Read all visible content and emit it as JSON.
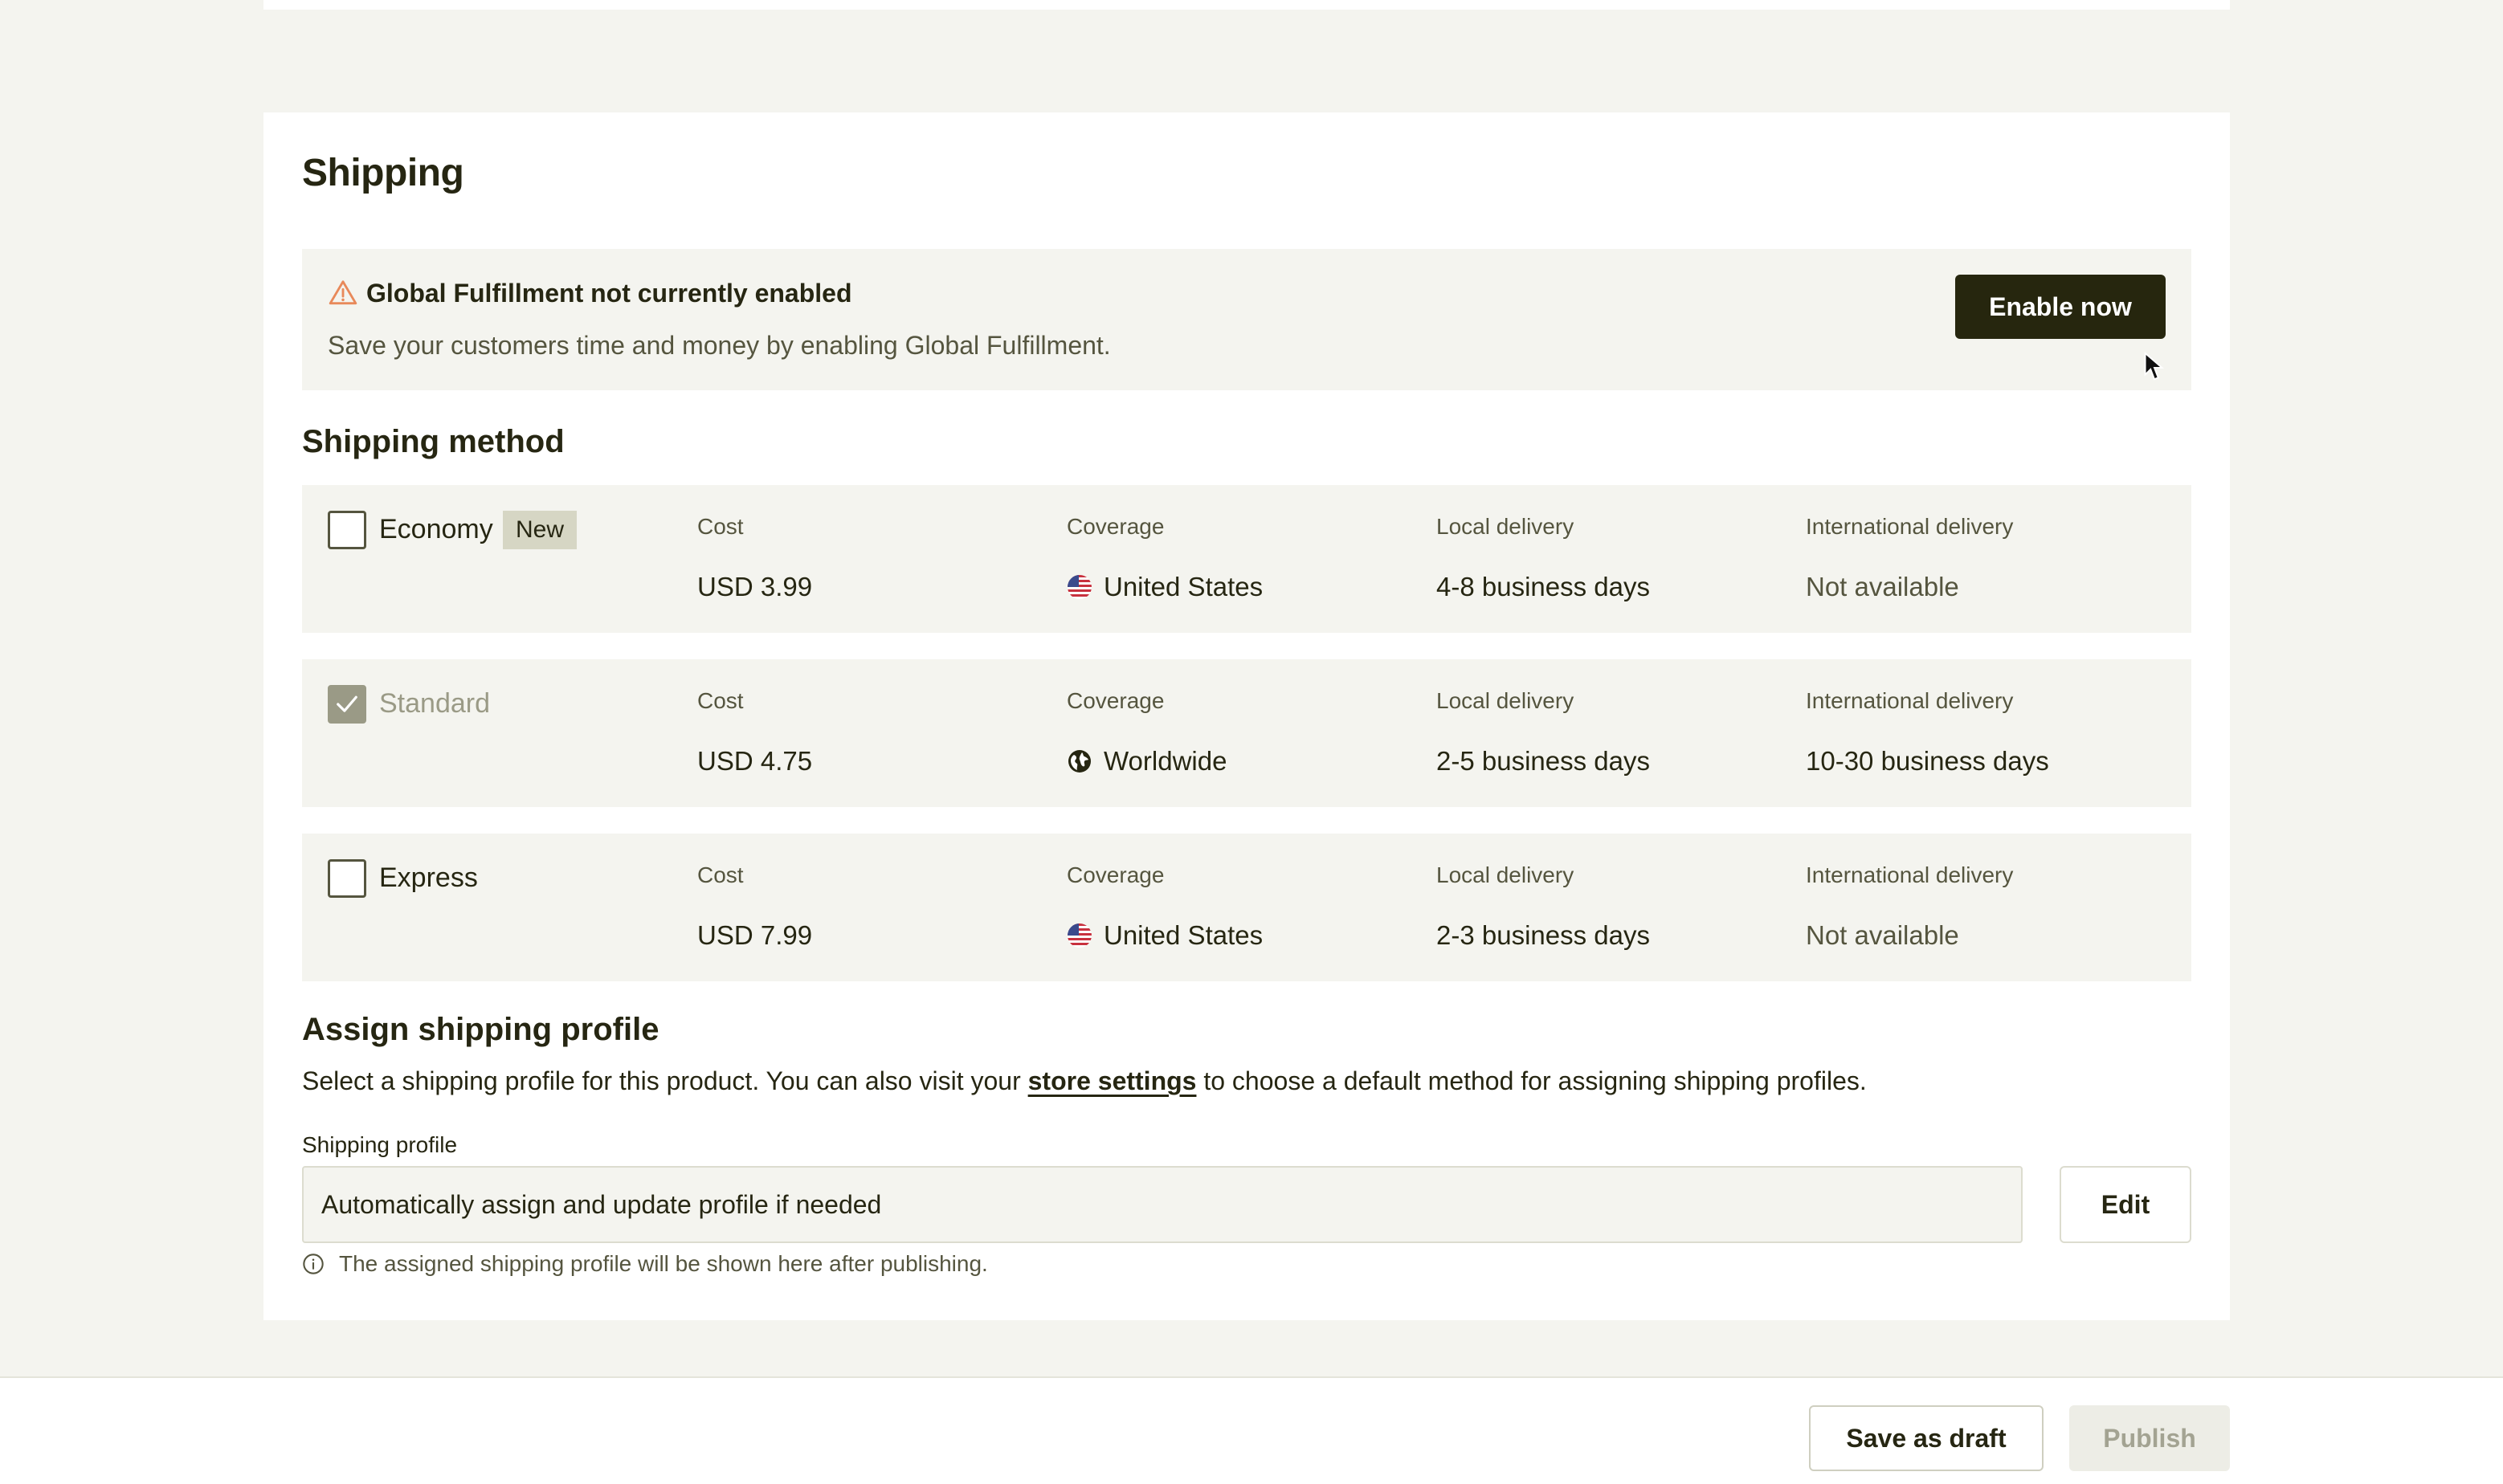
{
  "shipping": {
    "title": "Shipping",
    "banner": {
      "title": "Global Fulfillment not currently enabled",
      "description": "Save your customers time and money by enabling Global Fulfillment.",
      "button_label": "Enable now",
      "icon": "warning-triangle-icon",
      "icon_color": "#e8895a"
    },
    "method_heading": "Shipping method",
    "column_labels": {
      "cost": "Cost",
      "coverage": "Coverage",
      "local": "Local delivery",
      "international": "International delivery"
    },
    "methods": [
      {
        "name": "Economy",
        "badge": "New",
        "checked": false,
        "cost": "USD 3.99",
        "coverage": "United States",
        "coverage_icon": "us-flag-icon",
        "local": "4-8 business days",
        "international": "Not available"
      },
      {
        "name": "Standard",
        "checked": true,
        "disabled": true,
        "cost": "USD 4.75",
        "coverage": "Worldwide",
        "coverage_icon": "globe-icon",
        "local": "2-5 business days",
        "international": "10-30 business days"
      },
      {
        "name": "Express",
        "checked": false,
        "cost": "USD 7.99",
        "coverage": "United States",
        "coverage_icon": "us-flag-icon",
        "local": "2-3 business days",
        "international": "Not available"
      }
    ],
    "profile": {
      "heading": "Assign shipping profile",
      "desc_before": "Select a shipping profile for this product. You can also visit your ",
      "desc_link": "store settings",
      "desc_after": " to choose a default method for assigning shipping profiles.",
      "field_label": "Shipping profile",
      "field_value": "Automatically assign and update profile if needed",
      "edit_label": "Edit",
      "help_text": "The assigned shipping profile will be shown here after publishing."
    }
  },
  "footer": {
    "draft_label": "Save as draft",
    "publish_label": "Publish"
  },
  "colors": {
    "primary": "#26260e",
    "panel": "#f4f4ef",
    "muted_text": "#55553f"
  }
}
